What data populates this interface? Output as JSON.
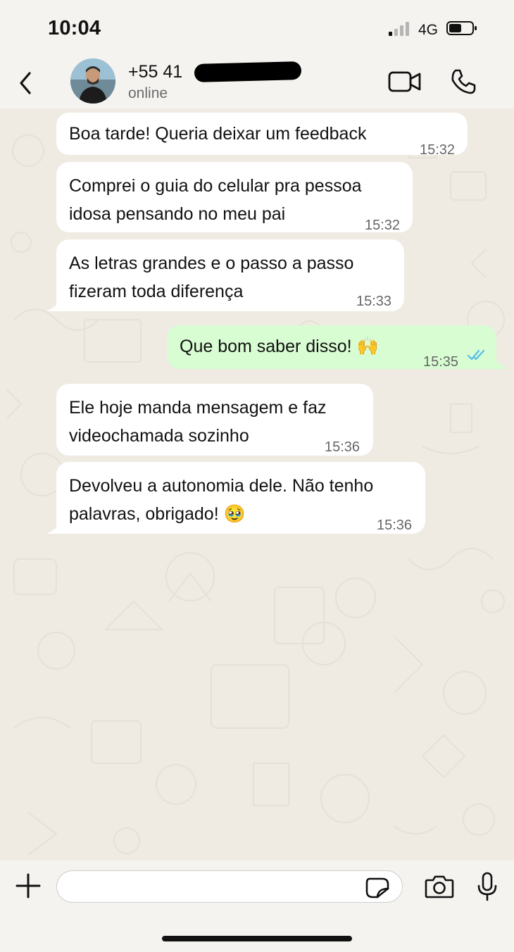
{
  "status_bar": {
    "time": "10:04",
    "network": "4G"
  },
  "header": {
    "contact_name": "+55 41",
    "contact_status": "online",
    "icons": {
      "back": "chevron-left-icon",
      "video": "video-camera-icon",
      "call": "phone-icon"
    }
  },
  "messages": [
    {
      "direction": "incoming",
      "text": "Boa tarde! Queria deixar um feedback",
      "time": "15:32"
    },
    {
      "direction": "incoming",
      "text": "Comprei o guia do celular pra pessoa\nidosa pensando no meu pai",
      "time": "15:32"
    },
    {
      "direction": "incoming",
      "text": "As letras grandes e o passo a passo\nfizeram toda diferença",
      "time": "15:33"
    },
    {
      "direction": "outgoing",
      "text": "Que bom saber disso! 🙌",
      "time": "15:35",
      "read": true
    },
    {
      "direction": "incoming",
      "text": "Ele hoje manda mensagem e faz\nvideochamada sozinho",
      "time": "15:36"
    },
    {
      "direction": "incoming",
      "text": "Devolveu a autonomia dele. Não tenho\npalavras, obrigado! 🥹",
      "time": "15:36"
    }
  ],
  "footer": {
    "input_value": "",
    "icons": {
      "plus": "plus-icon",
      "sticker": "sticker-icon",
      "camera": "camera-icon",
      "mic": "microphone-icon"
    }
  },
  "colors": {
    "incoming_bubble": "#ffffff",
    "outgoing_bubble": "#d9fdd3",
    "chat_bg": "#efeae2",
    "read_ticks": "#53bdeb"
  }
}
